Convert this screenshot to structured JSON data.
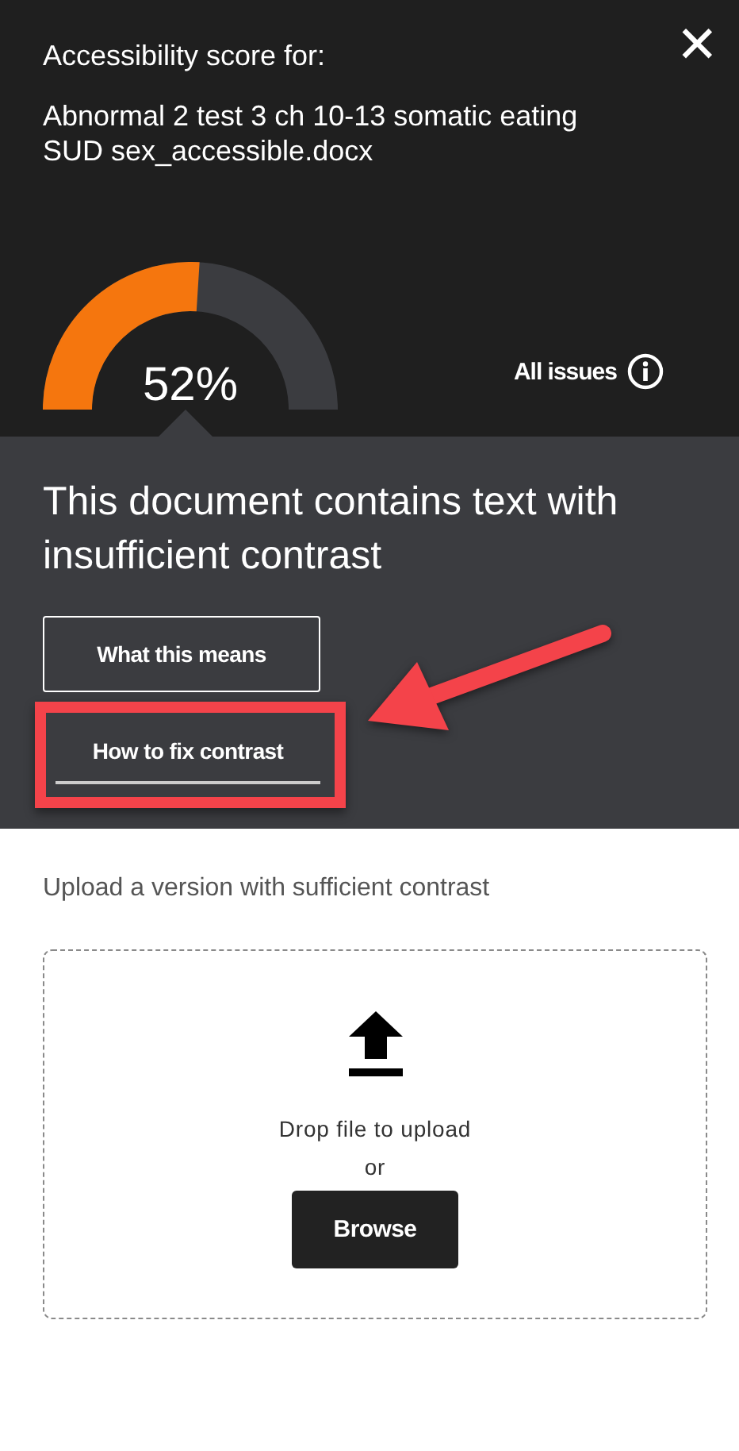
{
  "header": {
    "caption": "Accessibility score for:",
    "file_name": "Abnormal 2 test 3 ch 10-13 somatic eating SUD sex_accessible.docx",
    "close_label": "✕"
  },
  "score": {
    "reading": "52%",
    "all_issues_label": "All issues"
  },
  "issue": {
    "heading": "This document contains text with insufficient contrast",
    "actions": [
      {
        "label": "What this means",
        "highlighted": false
      },
      {
        "label": "How to fix contrast",
        "highlighted": true
      }
    ]
  },
  "upload": {
    "prompt": "Upload a version with sufficient contrast",
    "drop_text": "Drop file to upload",
    "or_text": "or",
    "browse_label": "Browse"
  }
}
